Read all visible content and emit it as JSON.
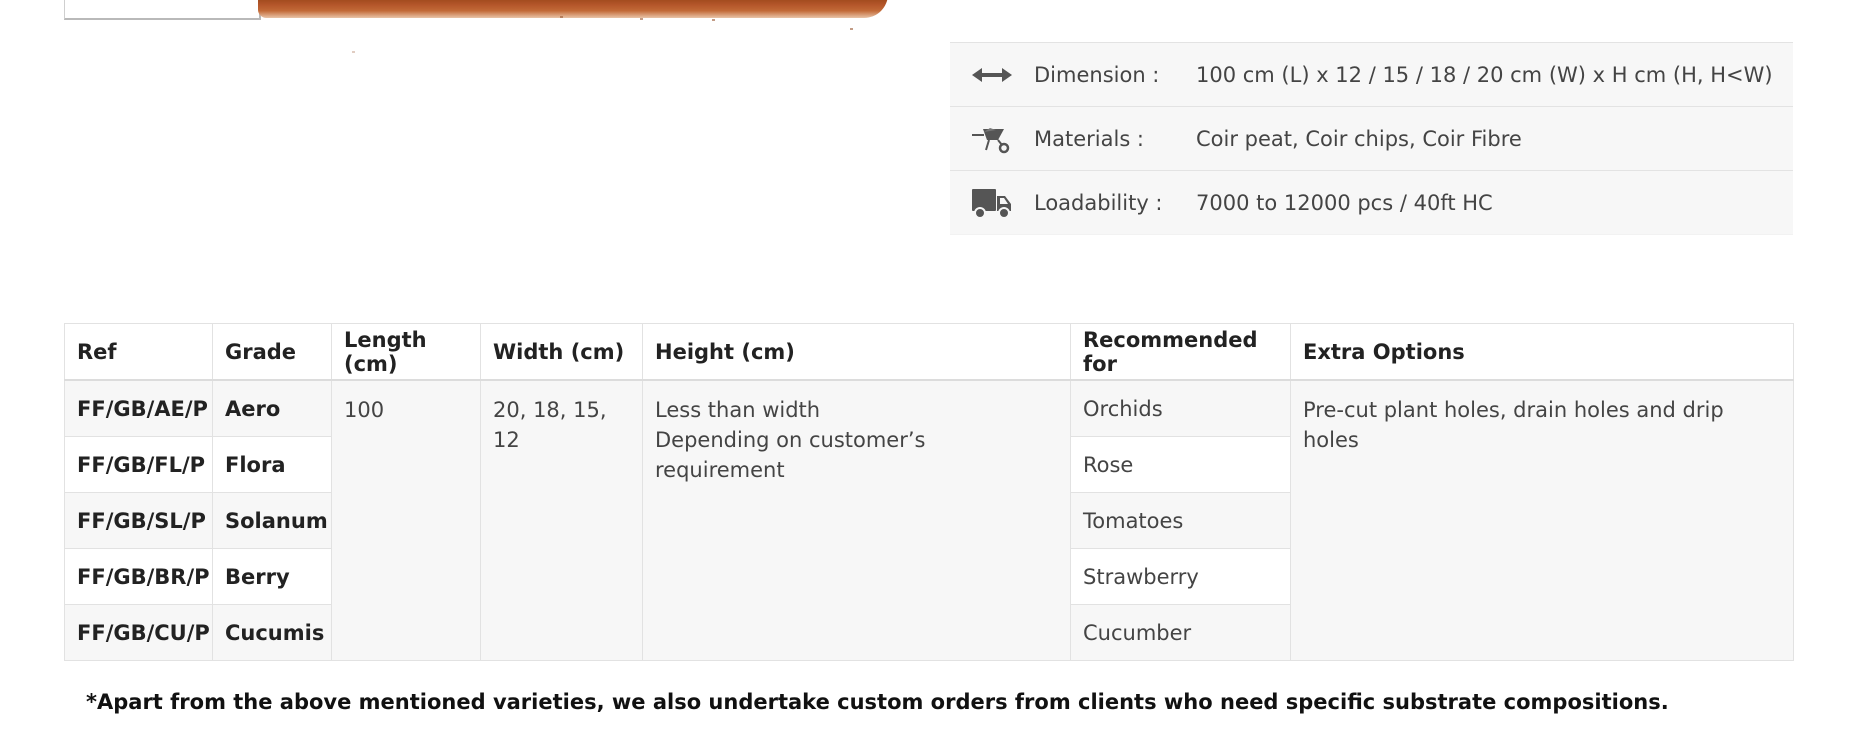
{
  "specs": [
    {
      "icon": "double-arrow-icon",
      "label": "Dimension :",
      "value": "100 cm (L) x 12 / 15 / 18 / 20 cm (W) x H cm (H, H<W)"
    },
    {
      "icon": "wheelbarrow-icon",
      "label": "Materials :",
      "value": "Coir peat, Coir chips, Coir Fibre"
    },
    {
      "icon": "truck-icon",
      "label": "Loadability :",
      "value": "7000 to 12000 pcs / 40ft HC"
    }
  ],
  "table": {
    "headers": [
      "Ref",
      "Grade",
      "Length (cm)",
      "Width (cm)",
      "Height (cm)",
      "Recommended for",
      "Extra Options"
    ],
    "rows": [
      {
        "ref": "FF/GB/AE/P",
        "grade": "Aero",
        "recommended": "Orchids"
      },
      {
        "ref": "FF/GB/FL/P",
        "grade": "Flora",
        "recommended": "Rose"
      },
      {
        "ref": "FF/GB/SL/P",
        "grade": "Solanum",
        "recommended": "Tomatoes"
      },
      {
        "ref": "FF/GB/BR/P",
        "grade": "Berry",
        "recommended": "Strawberry"
      },
      {
        "ref": "FF/GB/CU/P",
        "grade": "Cucumis",
        "recommended": "Cucumber"
      }
    ],
    "shared": {
      "length": "100",
      "width": "20, 18, 15, 12",
      "height_line1": "Less than width",
      "height_line2": "Depending on customer’s requirement",
      "extra": "Pre-cut plant holes, drain holes and drip holes"
    }
  },
  "footnote": "*Apart from the above mentioned varieties, we also undertake custom orders from clients who need specific substrate compositions."
}
